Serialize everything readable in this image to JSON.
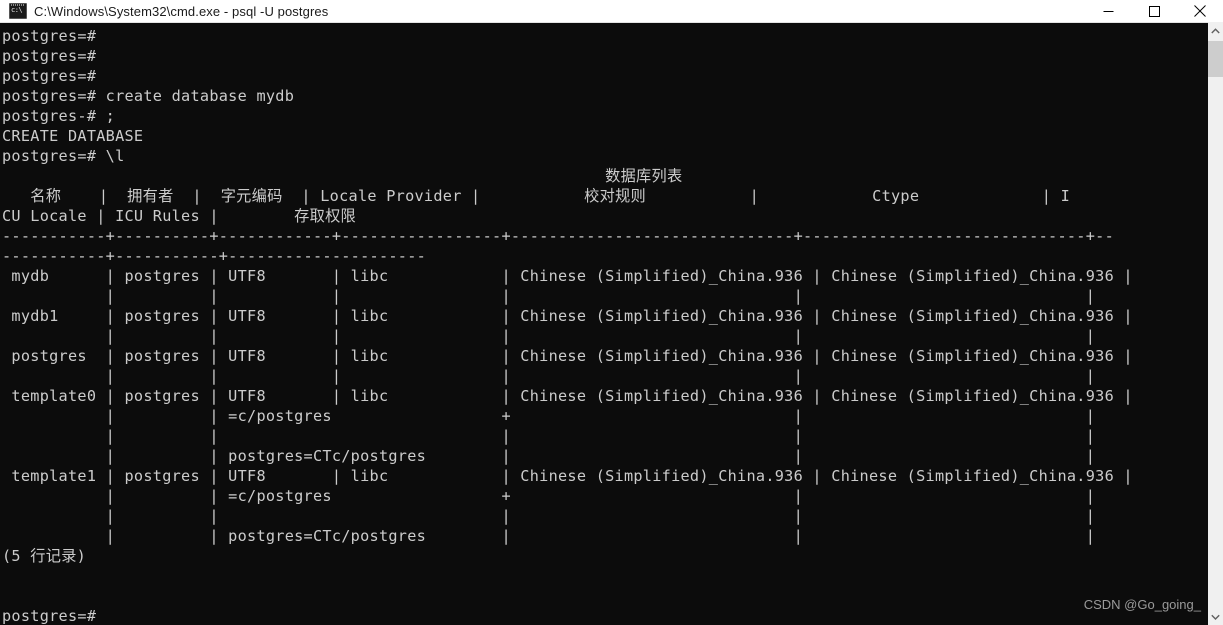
{
  "window": {
    "title": "C:\\Windows\\System32\\cmd.exe - psql  -U postgres",
    "icon": "cmd-icon",
    "controls": {
      "minimize": "minimize-icon",
      "maximize": "maximize-icon",
      "close": "close-icon"
    },
    "colors": {
      "titlebar_bg": "#ffffff",
      "titlebar_fg": "#1b1b1b",
      "terminal_bg": "#0c0c0c",
      "terminal_fg": "#cccccc",
      "scrollbar_track": "#f0f0f0",
      "scrollbar_thumb": "#cdcdcd"
    }
  },
  "scrollbar": {
    "up_arrow": "chevron-up-icon",
    "down_arrow": "chevron-down-icon",
    "thumb": "scrollbar-thumb"
  },
  "watermark": {
    "text": "CSDN @Go_going_"
  },
  "terminal": {
    "prompt": "postgres=#",
    "continuation_prompt": "postgres-#",
    "commands": [
      "create database mydb",
      ";",
      "\\l"
    ],
    "result_notice": "CREATE DATABASE",
    "row_count_footer": "(5 行记录)",
    "lines": [
      "postgres=#",
      "postgres=#",
      "postgres=#",
      "postgres=# create database mydb",
      "postgres-# ;",
      "CREATE DATABASE",
      "postgres=# \\l",
      "                                                                数据库列表",
      "   名称    |  拥有者  |  字元编码  | Locale Provider |           校对规则           |            Ctype             | I",
      "CU Locale | ICU Rules |        存取权限",
      "-----------+----------+------------+-----------------+------------------------------+------------------------------+--",
      "-----------+-----------+---------------------",
      " mydb      | postgres | UTF8       | libc            | Chinese (Simplified)_China.936 | Chinese (Simplified)_China.936 |",
      "           |          |            |                 |                              |                              |",
      " mydb1     | postgres | UTF8       | libc            | Chinese (Simplified)_China.936 | Chinese (Simplified)_China.936 |",
      "           |          |            |                 |                              |                              |",
      " postgres  | postgres | UTF8       | libc            | Chinese (Simplified)_China.936 | Chinese (Simplified)_China.936 |",
      "           |          |            |                 |                              |                              |",
      " template0 | postgres | UTF8       | libc            | Chinese (Simplified)_China.936 | Chinese (Simplified)_China.936 |",
      "           |          | =c/postgres                  +                              |                              |",
      "           |          |                              |                              |                              |",
      "           |          | postgres=CTc/postgres        |                              |                              |",
      " template1 | postgres | UTF8       | libc            | Chinese (Simplified)_China.936 | Chinese (Simplified)_China.936 |",
      "           |          | =c/postgres                  +                              |                              |",
      "           |          |                              |                              |                              |",
      "           |          | postgres=CTc/postgres        |                              |                              |",
      "(5 行记录)",
      "",
      "",
      "postgres=#"
    ]
  },
  "table": {
    "caption": "数据库列表",
    "headers_line1": [
      "名称",
      "拥有者",
      "字元编码",
      "Locale Provider",
      "校对规则",
      "Ctype",
      "ICU Locale"
    ],
    "headers_line2": [
      "ICU Rules",
      "存取权限"
    ],
    "rows": [
      {
        "name": "mydb",
        "owner": "postgres",
        "encoding": "UTF8",
        "locale_provider": "libc",
        "collate": "Chinese (Simplified)_China.936",
        "ctype": "Chinese (Simplified)_China.936",
        "privileges": ""
      },
      {
        "name": "mydb1",
        "owner": "postgres",
        "encoding": "UTF8",
        "locale_provider": "libc",
        "collate": "Chinese (Simplified)_China.936",
        "ctype": "Chinese (Simplified)_China.936",
        "privileges": ""
      },
      {
        "name": "postgres",
        "owner": "postgres",
        "encoding": "UTF8",
        "locale_provider": "libc",
        "collate": "Chinese (Simplified)_China.936",
        "ctype": "Chinese (Simplified)_China.936",
        "privileges": ""
      },
      {
        "name": "template0",
        "owner": "postgres",
        "encoding": "UTF8",
        "locale_provider": "libc",
        "collate": "Chinese (Simplified)_China.936",
        "ctype": "Chinese (Simplified)_China.936",
        "privileges": "=c/postgres\npostgres=CTc/postgres"
      },
      {
        "name": "template1",
        "owner": "postgres",
        "encoding": "UTF8",
        "locale_provider": "libc",
        "collate": "Chinese (Simplified)_China.936",
        "ctype": "Chinese (Simplified)_China.936",
        "privileges": "=c/postgres\npostgres=CTc/postgres"
      }
    ]
  }
}
